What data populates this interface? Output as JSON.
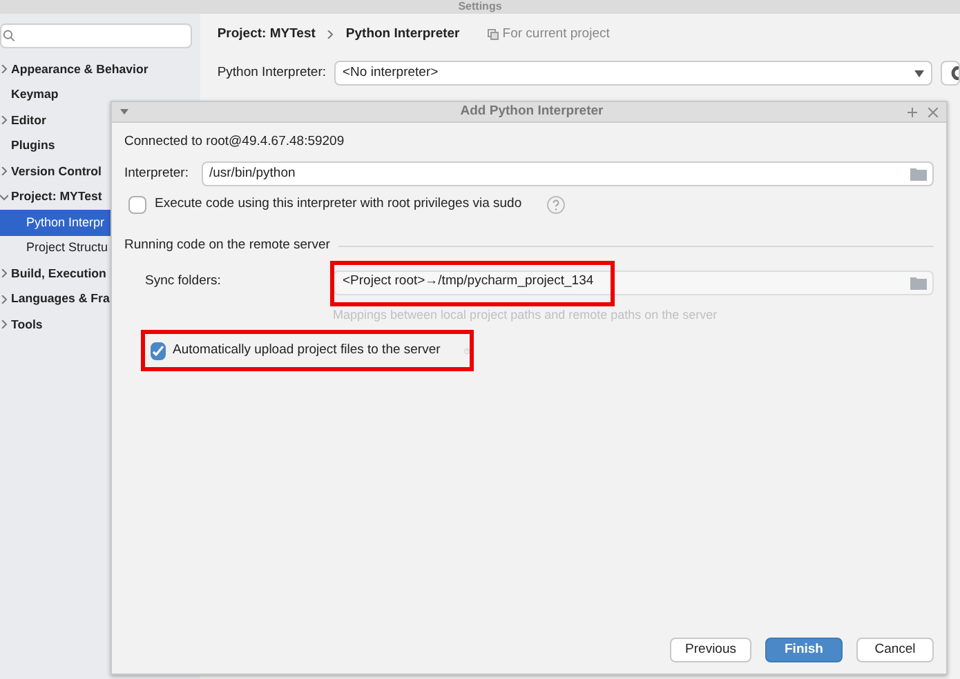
{
  "window": {
    "title": "Settings"
  },
  "sidebar": {
    "items": [
      {
        "label": "Appearance & Behavior",
        "expanded": false,
        "selected": false
      },
      {
        "label": "Keymap",
        "selected": false
      },
      {
        "label": "Editor",
        "expanded": false,
        "selected": false
      },
      {
        "label": "Plugins",
        "selected": false
      },
      {
        "label": "Version Control",
        "expanded": false,
        "selected": false
      },
      {
        "label": "Project: MYTest",
        "expanded": true,
        "selected": false,
        "children": [
          {
            "label": "Python Interpr",
            "selected": true
          },
          {
            "label": "Project Structu",
            "selected": false
          }
        ]
      },
      {
        "label": "Build, Execution",
        "expanded": false,
        "selected": false
      },
      {
        "label": "Languages & Fra",
        "expanded": false,
        "selected": false
      },
      {
        "label": "Tools",
        "expanded": false,
        "selected": false
      }
    ]
  },
  "breadcrumb": [
    "Project: MYTest",
    "Python Interpreter"
  ],
  "scope_note": "For current project",
  "interpreter_row": {
    "label": "Python Interpreter:",
    "value": "<No interpreter>"
  },
  "dialog": {
    "title": "Add Python Interpreter",
    "connection": "Connected to root@49.4.67.48:59209",
    "interpreter": {
      "label": "Interpreter:",
      "value": "/usr/bin/python"
    },
    "sudo": {
      "label": "Execute code using this interpreter with root privileges via sudo",
      "checked": false
    },
    "section": "Running code on the remote server",
    "sync": {
      "label": "Sync folders:",
      "value": "<Project root>→/tmp/pycharm_project_134",
      "hint": "Mappings between local project paths and remote paths on the server"
    },
    "upload": {
      "label": "Automatically upload project files to the server",
      "checked": true
    },
    "buttons": [
      {
        "label": "Previous",
        "primary": false
      },
      {
        "label": "Finish",
        "primary": true
      },
      {
        "label": "Cancel",
        "primary": false
      }
    ]
  }
}
